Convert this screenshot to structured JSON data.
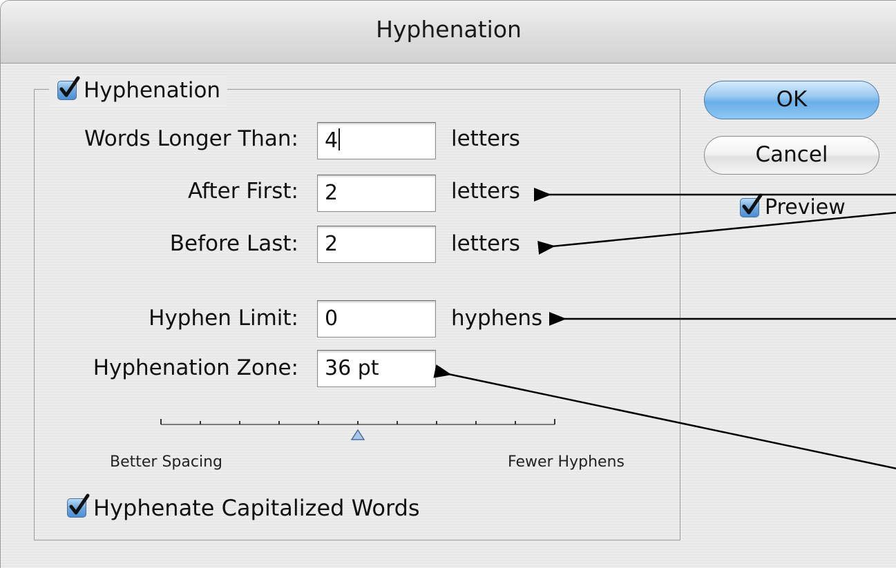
{
  "window": {
    "title": "Hyphenation"
  },
  "group": {
    "hyphenation_label": "Hyphenation",
    "hyphenation_checked": true
  },
  "fields": {
    "words_longer_than": {
      "label": "Words Longer Than:",
      "value": "4",
      "unit": "letters"
    },
    "after_first": {
      "label": "After First:",
      "value": "2",
      "unit": "letters"
    },
    "before_last": {
      "label": "Before Last:",
      "value": "2",
      "unit": "letters"
    },
    "hyphen_limit": {
      "label": "Hyphen Limit:",
      "value": "0",
      "unit": "hyphens"
    },
    "hyphenation_zone": {
      "label": "Hyphenation Zone:",
      "value": "36 pt"
    }
  },
  "slider": {
    "left_caption": "Better Spacing",
    "right_caption": "Fewer Hyphens",
    "tick_count": 11,
    "value_fraction": 0.5
  },
  "capitalized": {
    "label": "Hyphenate Capitalized Words",
    "checked": true
  },
  "buttons": {
    "ok_label": "OK",
    "cancel_label": "Cancel"
  },
  "preview": {
    "label": "Preview",
    "checked": true
  },
  "colors": {
    "accent_blue": "#6aaee8",
    "checkbox_blue": "#4c8fd6",
    "annotation_arrow": "#000000"
  }
}
